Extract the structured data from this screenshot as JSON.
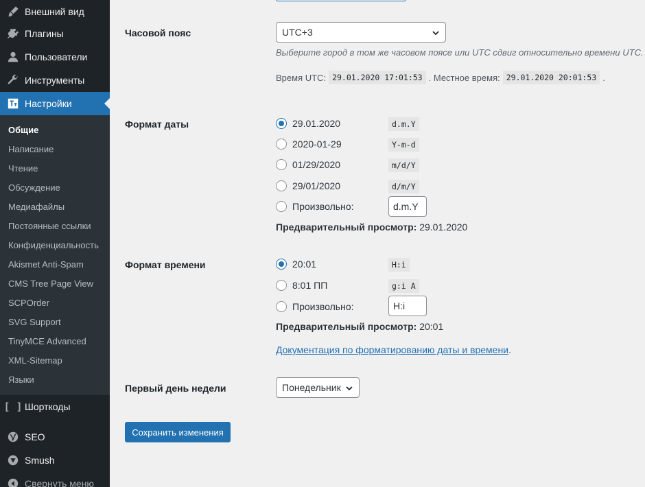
{
  "sidebar": {
    "menu_top": [
      {
        "label": "Внешний вид",
        "icon": "paintbrush-icon"
      },
      {
        "label": "Плагины",
        "icon": "plugins-icon"
      },
      {
        "label": "Пользователи",
        "icon": "users-icon"
      },
      {
        "label": "Инструменты",
        "icon": "wrench-icon"
      },
      {
        "label": "Настройки",
        "icon": "settings-icon"
      }
    ],
    "submenu": [
      {
        "label": "Общие"
      },
      {
        "label": "Написание"
      },
      {
        "label": "Чтение"
      },
      {
        "label": "Обсуждение"
      },
      {
        "label": "Медиафайлы"
      },
      {
        "label": "Постоянные ссылки"
      },
      {
        "label": "Конфиденциальность"
      },
      {
        "label": "Akismet Anti-Spam"
      },
      {
        "label": "CMS Tree Page View"
      },
      {
        "label": "SCPOrder"
      },
      {
        "label": "SVG Support"
      },
      {
        "label": "TinyMCE Advanced"
      },
      {
        "label": "XML-Sitemap"
      },
      {
        "label": "Языки"
      }
    ],
    "menu_bottom": [
      {
        "label": "Шорткоды",
        "icon": "brackets-icon"
      },
      {
        "label": "SEO",
        "icon": "yoast-icon"
      },
      {
        "label": "Smush",
        "icon": "smush-icon"
      },
      {
        "label": "Свернуть меню",
        "icon": "collapse-icon"
      }
    ]
  },
  "timezone": {
    "label": "Часовой пояс",
    "value": "UTC+3",
    "description": "Выберите город в том же часовом поясе или UTC сдвиг относительно времени UTC.",
    "utc_label": "Время UTC:",
    "utc_value": "29.01.2020 17:01:53",
    "local_label": ". Местное время:",
    "local_value": "29.01.2020 20:01:53",
    "end": "."
  },
  "date_format": {
    "label": "Формат даты",
    "options": [
      {
        "label": "29.01.2020",
        "code": "d.m.Y"
      },
      {
        "label": "2020-01-29",
        "code": "Y-m-d"
      },
      {
        "label": "01/29/2020",
        "code": "m/d/Y"
      },
      {
        "label": "29/01/2020",
        "code": "d/m/Y"
      }
    ],
    "custom_label": "Произвольно:",
    "custom_value": "d.m.Y",
    "preview_label": "Предварительный просмотр:",
    "preview_value": "29.01.2020"
  },
  "time_format": {
    "label": "Формат времени",
    "options": [
      {
        "label": "20:01",
        "code": "H:i"
      },
      {
        "label": "8:01 ПП",
        "code": "g:i A"
      }
    ],
    "custom_label": "Произвольно:",
    "custom_value": "H:i",
    "preview_label": "Предварительный просмотр:",
    "preview_value": "20:01"
  },
  "doc_link": {
    "text": "Документация по форматированию даты и времени",
    "end": "."
  },
  "week_start": {
    "label": "Первый день недели",
    "value": "Понедельник"
  },
  "save_label": "Сохранить изменения",
  "colors": {
    "accent": "#2271b1",
    "sidebar": "#1d2327",
    "submenu": "#2c3338",
    "background": "#f0f0f1"
  }
}
